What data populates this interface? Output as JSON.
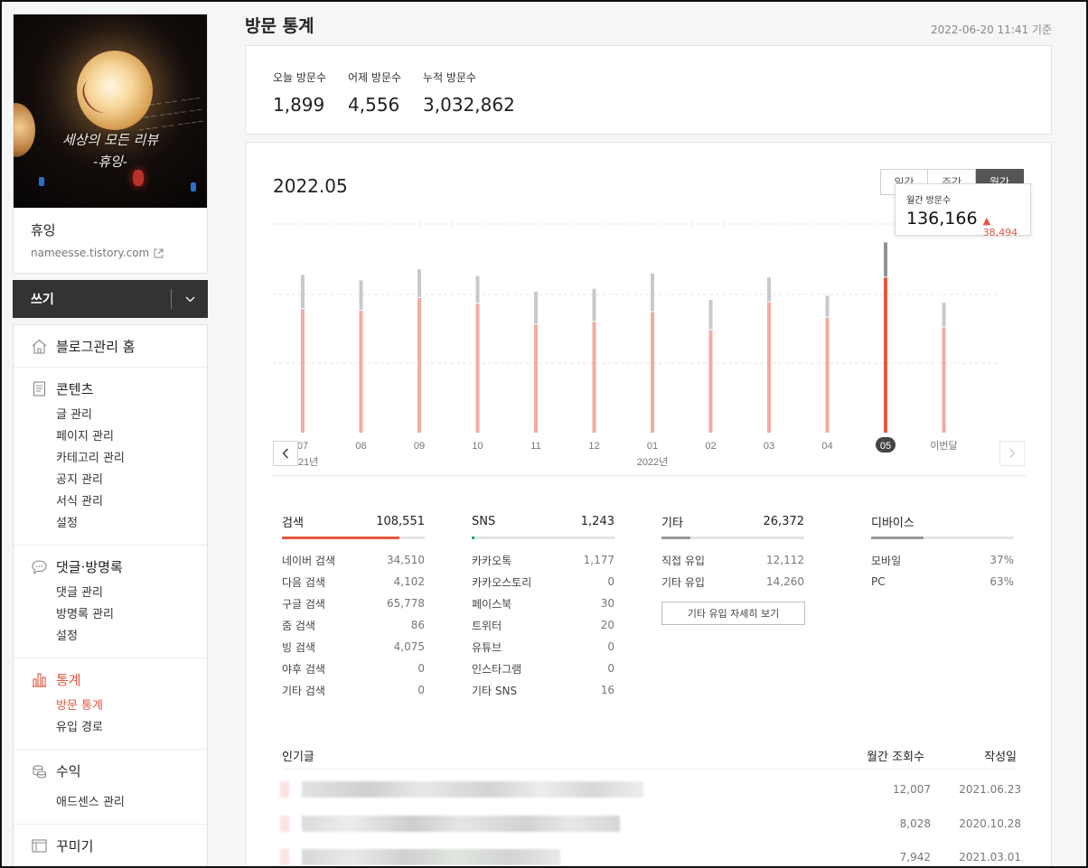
{
  "sidebar": {
    "image_text_line1": "세상의 모든 리뷰",
    "image_text_line2": "-휴잉-",
    "blog_name": "휴잉",
    "blog_url": "nameesse.tistory.com",
    "write_label": "쓰기",
    "menu": {
      "home": "블로그관리 홈",
      "contents": {
        "label": "콘텐츠",
        "items": [
          "글 관리",
          "페이지 관리",
          "카테고리 관리",
          "공지 관리",
          "서식 관리",
          "설정"
        ]
      },
      "comments": {
        "label": "댓글·방명록",
        "items": [
          "댓글 관리",
          "방명록 관리",
          "설정"
        ]
      },
      "stats": {
        "label": "통계",
        "items": [
          "방문 통계",
          "유입 경로"
        ]
      },
      "revenue": {
        "label": "수익",
        "items": [
          "애드센스 관리"
        ]
      },
      "decorate": {
        "label": "꾸미기"
      }
    }
  },
  "header": {
    "title": "방문 통계",
    "date": "2022-06-20 11:41 기준"
  },
  "summary": {
    "today_label": "오늘 방문수",
    "today_value": "1,899",
    "yesterday_label": "어제 방문수",
    "yesterday_value": "4,556",
    "total_label": "누적 방문수",
    "total_value": "3,032,862"
  },
  "chart": {
    "period": "2022.05",
    "tabs": [
      "일간",
      "주간",
      "월간"
    ],
    "active_tab": "월간",
    "tooltip_label": "월간 방문수",
    "tooltip_value": "136,166",
    "tooltip_delta": "38,494",
    "year_labels": [
      "2021년",
      "2022년"
    ]
  },
  "chart_data": {
    "type": "bar",
    "categories": [
      "07",
      "08",
      "09",
      "10",
      "11",
      "12",
      "01",
      "02",
      "03",
      "04",
      "05",
      "이번달"
    ],
    "series": [
      {
        "values": [
          89000,
          88000,
          97000,
          93000,
          78000,
          80000,
          87000,
          74000,
          94000,
          83000,
          136166,
          76000
        ]
      },
      {
        "values": [
          113000,
          109000,
          117000,
          112000,
          101000,
          103000,
          114000,
          95000,
          111000,
          98000,
          136166,
          93000
        ]
      }
    ],
    "highlight_category": "05",
    "colors": {
      "bar": "#f2aca0",
      "bar_active": "#e3573f",
      "top": "#c8c9cb",
      "top_active": "#8f9299"
    },
    "grid": true
  },
  "sources": {
    "search": {
      "title": "검색",
      "total": "108,551",
      "bar_color": "#e3573f",
      "fill": 0.82,
      "rows": [
        {
          "name": "네이버 검색",
          "value": "34,510"
        },
        {
          "name": "다음 검색",
          "value": "4,102"
        },
        {
          "name": "구글 검색",
          "value": "65,778"
        },
        {
          "name": "줌 검색",
          "value": "86"
        },
        {
          "name": "빙 검색",
          "value": "4,075"
        },
        {
          "name": "야후 검색",
          "value": "0"
        },
        {
          "name": "기타 검색",
          "value": "0"
        }
      ]
    },
    "sns": {
      "title": "SNS",
      "total": "1,243",
      "bar_color": "#1aa37a",
      "fill": 0.02,
      "rows": [
        {
          "name": "카카오톡",
          "value": "1,177"
        },
        {
          "name": "카카오스토리",
          "value": "0"
        },
        {
          "name": "페이스북",
          "value": "30"
        },
        {
          "name": "트위터",
          "value": "20"
        },
        {
          "name": "유튜브",
          "value": "0"
        },
        {
          "name": "인스타그램",
          "value": "0"
        },
        {
          "name": "기타 SNS",
          "value": "16"
        }
      ]
    },
    "other": {
      "title": "기타",
      "total": "26,372",
      "bar_color": "#999999",
      "fill": 0.2,
      "rows": [
        {
          "name": "직접 유입",
          "value": "12,112"
        },
        {
          "name": "기타 유입",
          "value": "14,260"
        }
      ],
      "detail_button": "기타 유입 자세히 보기"
    },
    "device": {
      "title": "디바이스",
      "bar_color": "#999999",
      "fill": 0.37,
      "rows": [
        {
          "name": "모바일",
          "value": "37%"
        },
        {
          "name": "PC",
          "value": "63%"
        }
      ]
    }
  },
  "popular": {
    "col_title": "인기글",
    "col_views": "월간 조회수",
    "col_date": "작성일",
    "rows": [
      {
        "views": "12,007",
        "date": "2021.06.23"
      },
      {
        "views": "8,028",
        "date": "2020.10.28"
      },
      {
        "views": "7,942",
        "date": "2021.03.01"
      }
    ]
  }
}
